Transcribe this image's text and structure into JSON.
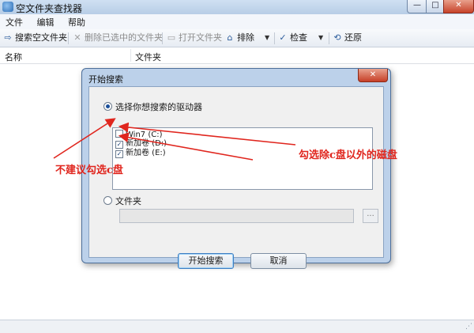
{
  "window": {
    "title": "空文件夹查找器",
    "icon": "folder-search-icon",
    "controls": {
      "minimize": "—",
      "maximize": "□",
      "close": "✕"
    }
  },
  "menubar": {
    "items": [
      "文件",
      "编辑",
      "帮助"
    ]
  },
  "toolbar": {
    "search_empty": {
      "label": "搜索空文件夹",
      "icon": "arrow-right-icon",
      "glyph": "⇨"
    },
    "delete_selected": {
      "label": "删除已选中的文件夹",
      "icon": "x-icon",
      "glyph": "✕"
    },
    "open_folder": {
      "label": "打开文件夹",
      "icon": "folder-open-icon",
      "glyph": "▭"
    },
    "exclude": {
      "label": "排除",
      "icon": "folder-exclude-icon",
      "glyph": "⌂"
    },
    "check": {
      "label": "检查",
      "icon": "check-icon",
      "glyph": "✓"
    },
    "restore": {
      "label": "还原",
      "icon": "refresh-icon",
      "glyph": "⟲"
    },
    "dropdown_glyph": "▼"
  },
  "columns": [
    "名称",
    "文件夹"
  ],
  "status": {
    "grip": "⋰"
  },
  "dialog": {
    "title": "开始搜索",
    "close_glyph": "✕",
    "option_drives": "选择你想搜索的驱动器",
    "drives": [
      {
        "label": "Win7 (C:)",
        "checked": false
      },
      {
        "label": "新加卷 (D:)",
        "checked": true
      },
      {
        "label": "新加卷 (E:)",
        "checked": true
      }
    ],
    "check_glyph": "✓",
    "option_folder": "文件夹",
    "browse_label": "...",
    "start_button": "开始搜索",
    "cancel_button": "取消"
  },
  "annotations": {
    "left": "不建议勾选c盘",
    "right": "勾选除c盘以外的磁盘",
    "color": "#e0261e"
  }
}
